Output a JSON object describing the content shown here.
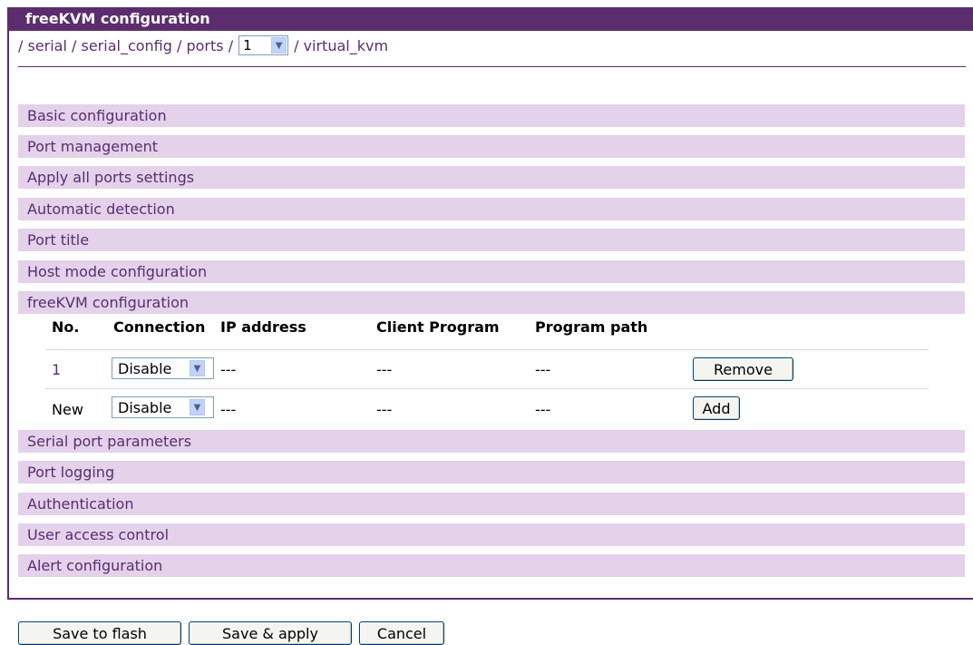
{
  "window": {
    "title": "freeKVM configuration"
  },
  "breadcrumb": {
    "prefix": "/ serial / serial_config / ports /",
    "port_value": "1",
    "suffix": "/ virtual_kvm"
  },
  "sections": [
    "Basic configuration",
    "Port management",
    "Apply all ports settings",
    "Automatic detection",
    "Port title",
    "Host mode configuration",
    "freeKVM configuration",
    "Serial port parameters",
    "Port logging",
    "Authentication",
    "User access control",
    "Alert configuration"
  ],
  "table": {
    "headers": [
      "No.",
      "Connection",
      "IP address",
      "Client Program",
      "Program path"
    ],
    "rows": [
      {
        "no": "1",
        "connection": "Disable",
        "ip": "---",
        "client": "---",
        "path": "---",
        "action": "Remove"
      },
      {
        "no": "New",
        "connection": "Disable",
        "ip": "---",
        "client": "---",
        "path": "---",
        "action": "Add"
      }
    ]
  },
  "footer": {
    "save_flash": "Save to flash",
    "save_apply": "Save & apply",
    "cancel": "Cancel"
  },
  "colors": {
    "accent": "#5b2d6e",
    "section_bg": "#e3d2ea"
  }
}
